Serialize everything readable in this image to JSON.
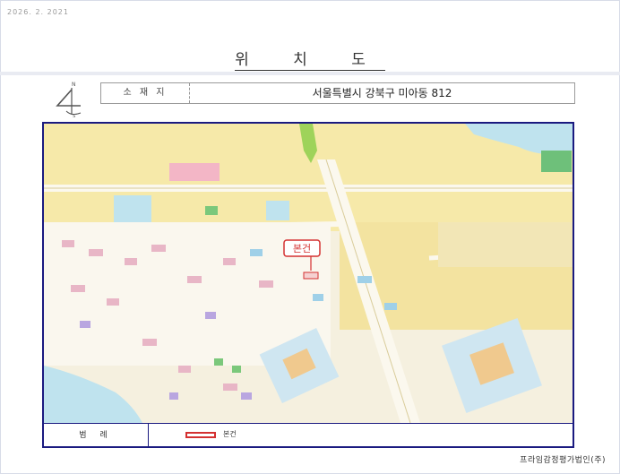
{
  "header": {
    "date": "2026. 2. 2021"
  },
  "title": "위 치 도",
  "compass": {
    "letter_top": "N",
    "letter_bottom": "S"
  },
  "location": {
    "label": "소 재 지",
    "address": "서울특별시 강북구 미아동 812"
  },
  "map": {
    "subject_label": "본건"
  },
  "legend": {
    "label": "범 례",
    "item_text": "본건",
    "item_color": "#d43030"
  },
  "footer": {
    "company": "프라임감정평가법인(주)"
  },
  "colors": {
    "frame": "#1a1a80",
    "accent": "#d43030"
  }
}
